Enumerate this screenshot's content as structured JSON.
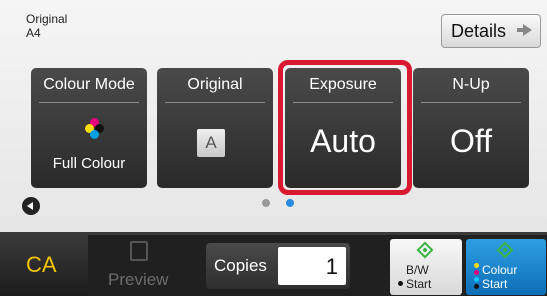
{
  "header": {
    "original_line1": "Original",
    "original_line2": "A4",
    "details_label": "Details"
  },
  "tiles": [
    {
      "title": "Colour Mode",
      "value": "Full Colour",
      "icon": "cmyk-dots-icon"
    },
    {
      "title": "Original",
      "value": "A",
      "icon": "page-a-icon"
    },
    {
      "title": "Exposure",
      "value": "Auto",
      "highlighted": true
    },
    {
      "title": "N-Up",
      "value": "Off"
    }
  ],
  "pager": {
    "page_count": 2,
    "active_page": 2
  },
  "bottom": {
    "ca_label": "CA",
    "preview_label": "Preview",
    "copies_label": "Copies",
    "copies_value": "1",
    "bw_line1": "B/W",
    "bw_line2": "Start",
    "colour_line1": "Colour",
    "colour_line2": "Start"
  },
  "colors": {
    "highlight": "#d8192f",
    "ca_text": "#f4c400",
    "colour_start": "#1a86cf",
    "start_icon": "#3cb441",
    "pager_active": "#2a8be0"
  }
}
